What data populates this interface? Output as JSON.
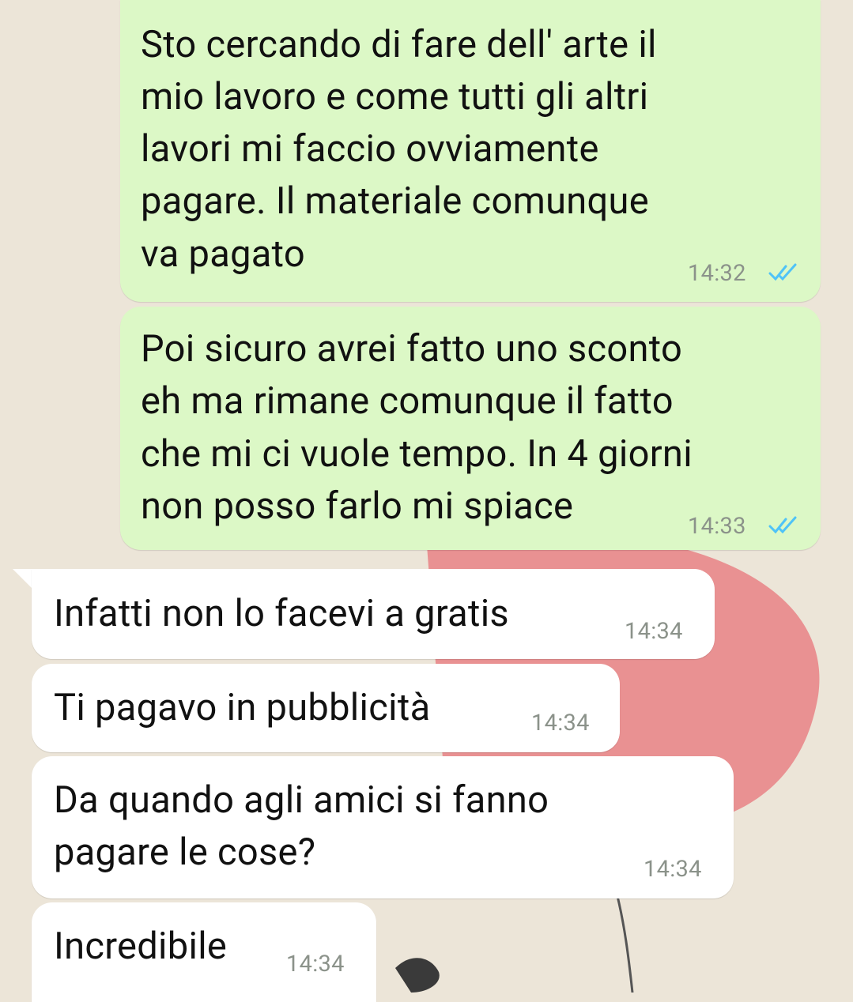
{
  "colors": {
    "outgoing_bubble": "#dcf8c6",
    "incoming_bubble": "#ffffff",
    "read_ticks": "#4fc3f7",
    "timestamp": "#8b928a",
    "wallpaper": "#ece5d8",
    "balloon": "#e88a8c"
  },
  "messages": [
    {
      "direction": "outgoing",
      "lines": [
        "Sto cercando di fare dell' arte il",
        "mio lavoro e come tutti gli altri",
        "lavori mi faccio ovviamente",
        "pagare. Il materiale comunque",
        "va pagato"
      ],
      "time": "14:32",
      "status_icon": "double-check-read-icon"
    },
    {
      "direction": "outgoing",
      "lines": [
        "Poi sicuro avrei fatto uno sconto",
        "eh ma rimane comunque il fatto",
        "che mi ci vuole tempo. In 4 giorni",
        "non posso farlo mi spiace"
      ],
      "time": "14:33",
      "status_icon": "double-check-read-icon"
    },
    {
      "direction": "incoming",
      "lines": [
        "Infatti non lo facevi a gratis"
      ],
      "time": "14:34"
    },
    {
      "direction": "incoming",
      "lines": [
        "Ti pagavo in pubblicità"
      ],
      "time": "14:34"
    },
    {
      "direction": "incoming",
      "lines": [
        "Da quando agli amici si fanno",
        "pagare le cose?"
      ],
      "time": "14:34"
    },
    {
      "direction": "incoming",
      "lines": [
        "Incredibile"
      ],
      "time": "14:34"
    }
  ]
}
